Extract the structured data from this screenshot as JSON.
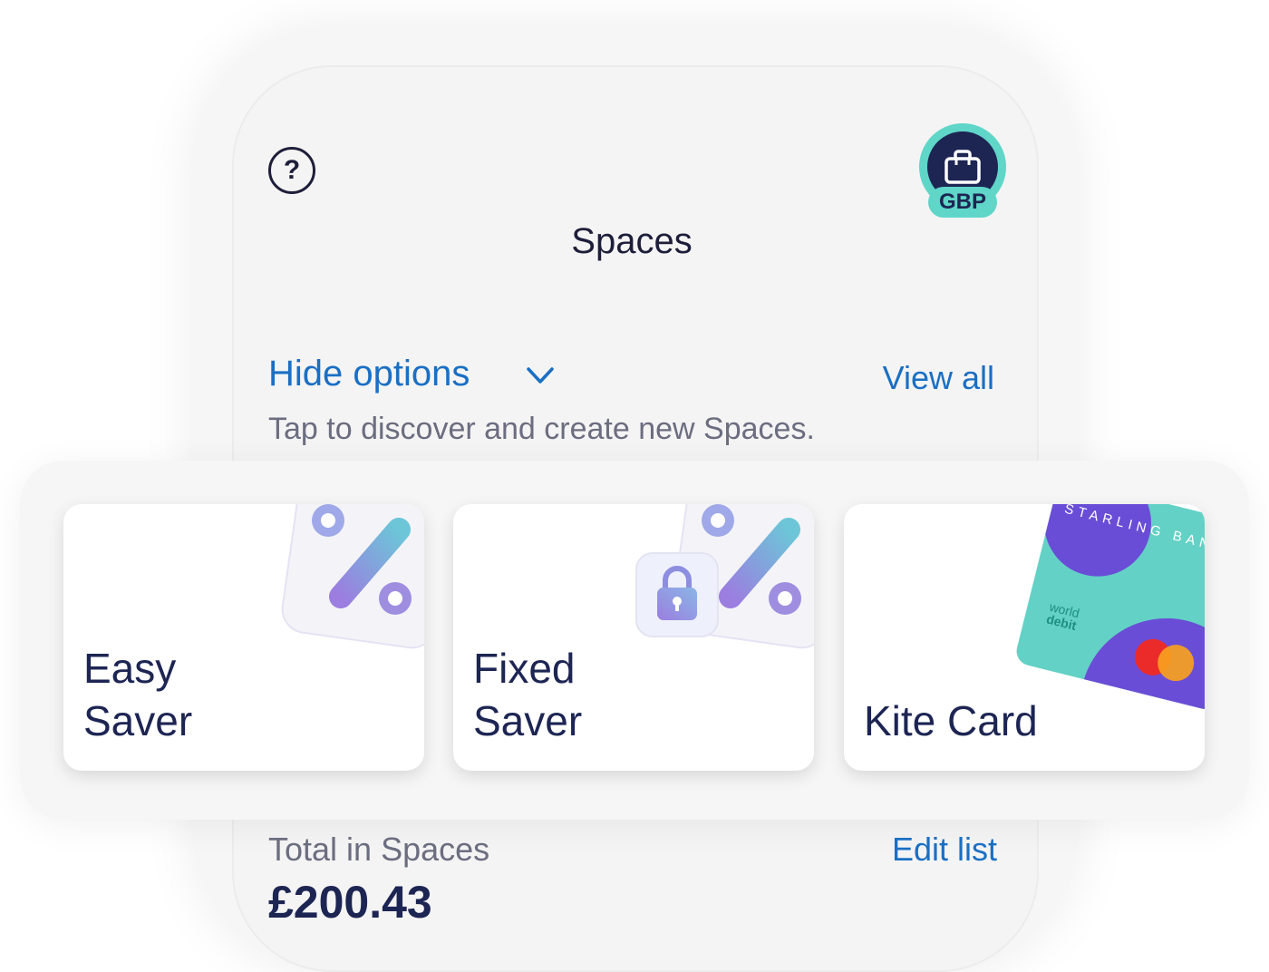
{
  "header": {
    "title": "Spaces",
    "help_icon_glyph": "?",
    "account_badge": "GBP"
  },
  "options": {
    "hide_label": "Hide options",
    "view_all_label": "View all",
    "subtitle": "Tap to discover and create new Spaces."
  },
  "cards": [
    {
      "line1": "Easy",
      "line2": "Saver",
      "icon": "percent-icon"
    },
    {
      "line1": "Fixed",
      "line2": "Saver",
      "icon": "padlock-percent-icon"
    },
    {
      "line1": "Kite Card",
      "line2": "",
      "icon": "debit-card-icon",
      "card_brand_text": "STARLING BAN",
      "card_type_line1": "world",
      "card_type_line2": "debit"
    }
  ],
  "totals": {
    "label": "Total in Spaces",
    "edit_label": "Edit list",
    "value": "£200.43"
  },
  "colors": {
    "link": "#1a6fc4",
    "navy": "#1d2553",
    "teal": "#5fd6c8",
    "purple": "#6a4dd6"
  }
}
